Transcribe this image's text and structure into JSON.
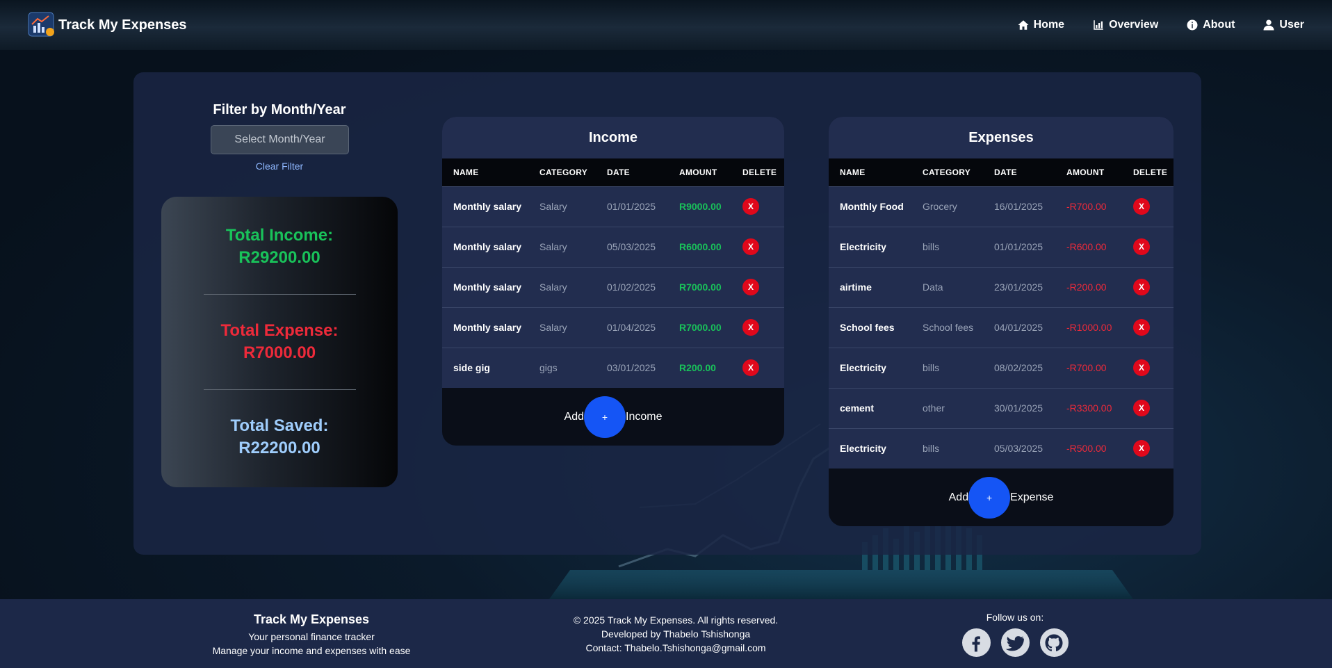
{
  "app": {
    "title": "Track My Expenses"
  },
  "nav": {
    "items": [
      {
        "label": "Home",
        "icon": "home-icon"
      },
      {
        "label": "Overview",
        "icon": "bar-chart-icon"
      },
      {
        "label": "About",
        "icon": "info-icon"
      },
      {
        "label": "User",
        "icon": "user-icon"
      }
    ]
  },
  "filter": {
    "title": "Filter by Month/Year",
    "placeholder": "Select Month/Year",
    "clear_label": "Clear Filter"
  },
  "summary": {
    "income_label": "Total Income:",
    "income_value": "R29200.00",
    "expense_label": "Total Expense:",
    "expense_value": "R7000.00",
    "saved_label": "Total Saved:",
    "saved_value": "R22200.00"
  },
  "income": {
    "title": "Income",
    "columns": [
      "NAME",
      "CATEGORY",
      "DATE",
      "AMOUNT",
      "DELETE"
    ],
    "rows": [
      {
        "name": "Monthly salary",
        "category": "Salary",
        "date": "01/01/2025",
        "amount": "R9000.00"
      },
      {
        "name": "Monthly salary",
        "category": "Salary",
        "date": "05/03/2025",
        "amount": "R6000.00"
      },
      {
        "name": "Monthly salary",
        "category": "Salary",
        "date": "01/02/2025",
        "amount": "R7000.00"
      },
      {
        "name": "Monthly salary",
        "category": "Salary",
        "date": "01/04/2025",
        "amount": "R7000.00"
      },
      {
        "name": "side gig",
        "category": "gigs",
        "date": "03/01/2025",
        "amount": "R200.00"
      }
    ],
    "delete_label": "X",
    "add_prefix": "Add",
    "add_button": "+",
    "add_suffix": "Income"
  },
  "expenses": {
    "title": "Expenses",
    "columns": [
      "NAME",
      "CATEGORY",
      "DATE",
      "AMOUNT",
      "DELETE"
    ],
    "rows": [
      {
        "name": "Monthly Food",
        "category": "Grocery",
        "date": "16/01/2025",
        "amount": "-R700.00"
      },
      {
        "name": "Electricity",
        "category": "bills",
        "date": "01/01/2025",
        "amount": "-R600.00"
      },
      {
        "name": "airtime",
        "category": "Data",
        "date": "23/01/2025",
        "amount": "-R200.00"
      },
      {
        "name": "School fees",
        "category": "School fees",
        "date": "04/01/2025",
        "amount": "-R1000.00"
      },
      {
        "name": "Electricity",
        "category": "bills",
        "date": "08/02/2025",
        "amount": "-R700.00"
      },
      {
        "name": "cement",
        "category": "other",
        "date": "30/01/2025",
        "amount": "-R3300.00"
      },
      {
        "name": "Electricity",
        "category": "bills",
        "date": "05/03/2025",
        "amount": "-R500.00"
      }
    ],
    "delete_label": "X",
    "add_prefix": "Add",
    "add_button": "+",
    "add_suffix": "Expense"
  },
  "footer": {
    "brand_title": "Track My Expenses",
    "tagline_1": "Your personal finance tracker",
    "tagline_2": "Manage your income and expenses with ease",
    "copyright": "© 2025 Track My Expenses. All rights reserved.",
    "developer": "Developed by Thabelo Tshishonga",
    "contact": "Contact: Thabelo.Tshishonga@gmail.com",
    "follow_label": "Follow us on:",
    "social": [
      "facebook-icon",
      "twitter-icon",
      "github-icon"
    ]
  },
  "colors": {
    "income_green": "#19c25a",
    "expense_red": "#ee2a3a",
    "saved_blue": "#9fcdfc",
    "accent_blue": "#1555f5",
    "delete_red": "#e0081b"
  }
}
